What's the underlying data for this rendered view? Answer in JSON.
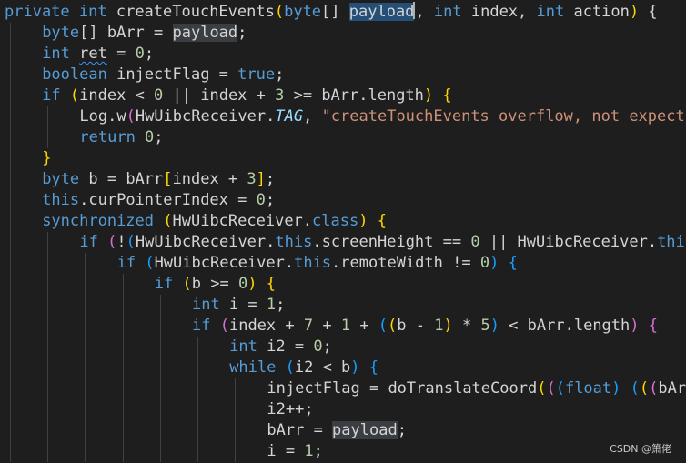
{
  "editor": {
    "lines": [
      {
        "indent": 0,
        "tokens": [
          {
            "t": "private ",
            "c": "kw"
          },
          {
            "t": "int ",
            "c": "kw"
          },
          {
            "t": "createTouchEvents",
            "c": "txt"
          },
          {
            "t": "(",
            "c": "b1"
          },
          {
            "t": "byte",
            "c": "kw"
          },
          {
            "t": "[] ",
            "c": "txt"
          },
          {
            "t": "payload",
            "c": "txt",
            "hl": "sel"
          },
          {
            "cursor": true
          },
          {
            "t": ", ",
            "c": "txt"
          },
          {
            "t": "int ",
            "c": "kw"
          },
          {
            "t": "index, ",
            "c": "txt"
          },
          {
            "t": "int ",
            "c": "kw"
          },
          {
            "t": "action",
            "c": "txt"
          },
          {
            "t": ")",
            "c": "b1"
          },
          {
            "t": " {",
            "c": "txt"
          }
        ]
      },
      {
        "indent": 1,
        "tokens": [
          {
            "t": "byte",
            "c": "kw"
          },
          {
            "t": "[] bArr = ",
            "c": "txt"
          },
          {
            "t": "payload",
            "c": "txt",
            "hl": "occ"
          },
          {
            "t": ";",
            "c": "txt"
          }
        ]
      },
      {
        "indent": 1,
        "tokens": [
          {
            "t": "int ",
            "c": "kw"
          },
          {
            "t": "ret",
            "c": "txt",
            "squiggle": true
          },
          {
            "t": " = ",
            "c": "txt"
          },
          {
            "t": "0",
            "c": "num"
          },
          {
            "t": ";",
            "c": "txt"
          }
        ]
      },
      {
        "indent": 1,
        "tokens": [
          {
            "t": "boolean ",
            "c": "kw"
          },
          {
            "t": "injectFlag = ",
            "c": "txt"
          },
          {
            "t": "true",
            "c": "kw"
          },
          {
            "t": ";",
            "c": "txt"
          }
        ]
      },
      {
        "indent": 1,
        "tokens": [
          {
            "t": "if ",
            "c": "kw"
          },
          {
            "t": "(",
            "c": "b1"
          },
          {
            "t": "index < ",
            "c": "txt"
          },
          {
            "t": "0",
            "c": "num"
          },
          {
            "t": " || index + ",
            "c": "txt"
          },
          {
            "t": "3",
            "c": "num"
          },
          {
            "t": " >= bArr.length",
            "c": "txt"
          },
          {
            "t": ")",
            "c": "b1"
          },
          {
            "t": " ",
            "c": "txt"
          },
          {
            "t": "{",
            "c": "b1"
          }
        ]
      },
      {
        "indent": 2,
        "tokens": [
          {
            "t": "Log.w",
            "c": "txt"
          },
          {
            "t": "(",
            "c": "b2"
          },
          {
            "t": "HwUibcReceiver.",
            "c": "txt"
          },
          {
            "t": "TAG",
            "c": "italic-const"
          },
          {
            "t": ", ",
            "c": "txt"
          },
          {
            "t": "\"createTouchEvents overflow, not expect",
            "c": "str"
          }
        ]
      },
      {
        "indent": 2,
        "tokens": [
          {
            "t": "return ",
            "c": "kw"
          },
          {
            "t": "0",
            "c": "num"
          },
          {
            "t": ";",
            "c": "txt"
          }
        ]
      },
      {
        "indent": 1,
        "tokens": [
          {
            "t": "}",
            "c": "b1"
          }
        ]
      },
      {
        "indent": 1,
        "tokens": [
          {
            "t": "byte ",
            "c": "kw"
          },
          {
            "t": "b = bArr",
            "c": "txt"
          },
          {
            "t": "[",
            "c": "b1"
          },
          {
            "t": "index + ",
            "c": "txt"
          },
          {
            "t": "3",
            "c": "num"
          },
          {
            "t": "]",
            "c": "b1"
          },
          {
            "t": ";",
            "c": "txt"
          }
        ]
      },
      {
        "indent": 1,
        "tokens": [
          {
            "t": "this",
            "c": "kw"
          },
          {
            "t": ".curPointerIndex = ",
            "c": "txt"
          },
          {
            "t": "0",
            "c": "num"
          },
          {
            "t": ";",
            "c": "txt"
          }
        ]
      },
      {
        "indent": 1,
        "tokens": [
          {
            "t": "synchronized ",
            "c": "kw"
          },
          {
            "t": "(",
            "c": "b1"
          },
          {
            "t": "HwUibcReceiver.",
            "c": "txt"
          },
          {
            "t": "class",
            "c": "kw"
          },
          {
            "t": ")",
            "c": "b1"
          },
          {
            "t": " ",
            "c": "txt"
          },
          {
            "t": "{",
            "c": "b1"
          }
        ]
      },
      {
        "indent": 2,
        "tokens": [
          {
            "t": "if ",
            "c": "kw"
          },
          {
            "t": "(",
            "c": "b2"
          },
          {
            "t": "!",
            "c": "txt"
          },
          {
            "t": "(",
            "c": "b3"
          },
          {
            "t": "HwUibcReceiver.",
            "c": "txt"
          },
          {
            "t": "this",
            "c": "kw"
          },
          {
            "t": ".screenHeight == ",
            "c": "txt"
          },
          {
            "t": "0",
            "c": "num"
          },
          {
            "t": " || HwUibcReceiver.",
            "c": "txt"
          },
          {
            "t": "thi",
            "c": "kw"
          }
        ]
      },
      {
        "indent": 3,
        "tokens": [
          {
            "t": "if ",
            "c": "kw"
          },
          {
            "t": "(",
            "c": "b3"
          },
          {
            "t": "HwUibcReceiver.",
            "c": "txt"
          },
          {
            "t": "this",
            "c": "kw"
          },
          {
            "t": ".remoteWidth != ",
            "c": "txt"
          },
          {
            "t": "0",
            "c": "num"
          },
          {
            "t": ")",
            "c": "b3"
          },
          {
            "t": " ",
            "c": "txt"
          },
          {
            "t": "{",
            "c": "b3"
          }
        ]
      },
      {
        "indent": 4,
        "tokens": [
          {
            "t": "if ",
            "c": "kw"
          },
          {
            "t": "(",
            "c": "b1"
          },
          {
            "t": "b >= ",
            "c": "txt"
          },
          {
            "t": "0",
            "c": "num"
          },
          {
            "t": ")",
            "c": "b1"
          },
          {
            "t": " ",
            "c": "txt"
          },
          {
            "t": "{",
            "c": "b1"
          }
        ]
      },
      {
        "indent": 5,
        "tokens": [
          {
            "t": "int ",
            "c": "kw"
          },
          {
            "t": "i = ",
            "c": "txt"
          },
          {
            "t": "1",
            "c": "num"
          },
          {
            "t": ";",
            "c": "txt"
          }
        ]
      },
      {
        "indent": 5,
        "tokens": [
          {
            "t": "if ",
            "c": "kw"
          },
          {
            "t": "(",
            "c": "b2"
          },
          {
            "t": "index + ",
            "c": "txt"
          },
          {
            "t": "7",
            "c": "num"
          },
          {
            "t": " + ",
            "c": "txt"
          },
          {
            "t": "1",
            "c": "num"
          },
          {
            "t": " + ",
            "c": "txt"
          },
          {
            "t": "(",
            "c": "b3"
          },
          {
            "t": "(",
            "c": "b1"
          },
          {
            "t": "b - ",
            "c": "txt"
          },
          {
            "t": "1",
            "c": "num"
          },
          {
            "t": ")",
            "c": "b1"
          },
          {
            "t": " * ",
            "c": "txt"
          },
          {
            "t": "5",
            "c": "num"
          },
          {
            "t": ")",
            "c": "b3"
          },
          {
            "t": " < bArr.length",
            "c": "txt"
          },
          {
            "t": ")",
            "c": "b2"
          },
          {
            "t": " ",
            "c": "txt"
          },
          {
            "t": "{",
            "c": "b2"
          }
        ]
      },
      {
        "indent": 6,
        "tokens": [
          {
            "t": "int ",
            "c": "kw"
          },
          {
            "t": "i2 = ",
            "c": "txt"
          },
          {
            "t": "0",
            "c": "num"
          },
          {
            "t": ";",
            "c": "txt"
          }
        ]
      },
      {
        "indent": 6,
        "tokens": [
          {
            "t": "while ",
            "c": "kw"
          },
          {
            "t": "(",
            "c": "b3"
          },
          {
            "t": "i2 < b",
            "c": "txt"
          },
          {
            "t": ")",
            "c": "b3"
          },
          {
            "t": " ",
            "c": "txt"
          },
          {
            "t": "{",
            "c": "b3"
          }
        ]
      },
      {
        "indent": 7,
        "tokens": [
          {
            "t": "injectFlag = doTranslateCoord",
            "c": "txt"
          },
          {
            "t": "(",
            "c": "b1"
          },
          {
            "t": "(",
            "c": "b2"
          },
          {
            "t": "(",
            "c": "b3"
          },
          {
            "t": "float",
            "c": "kw"
          },
          {
            "t": ")",
            "c": "b3"
          },
          {
            "t": " ",
            "c": "txt"
          },
          {
            "t": "(",
            "c": "b3"
          },
          {
            "t": "(",
            "c": "b1"
          },
          {
            "t": "(",
            "c": "b2"
          },
          {
            "t": "bAr",
            "c": "txt"
          }
        ]
      },
      {
        "indent": 7,
        "tokens": [
          {
            "t": "i2++;",
            "c": "txt"
          }
        ]
      },
      {
        "indent": 7,
        "tokens": [
          {
            "t": "bArr = ",
            "c": "txt"
          },
          {
            "t": "payload",
            "c": "txt",
            "hl": "occ"
          },
          {
            "t": ";",
            "c": "txt"
          }
        ]
      },
      {
        "indent": 7,
        "tokens": [
          {
            "t": "i = ",
            "c": "txt"
          },
          {
            "t": "1",
            "c": "num"
          },
          {
            "t": ";",
            "c": "txt"
          }
        ]
      }
    ]
  },
  "watermark": {
    "text": "CSDN @箫佬"
  }
}
